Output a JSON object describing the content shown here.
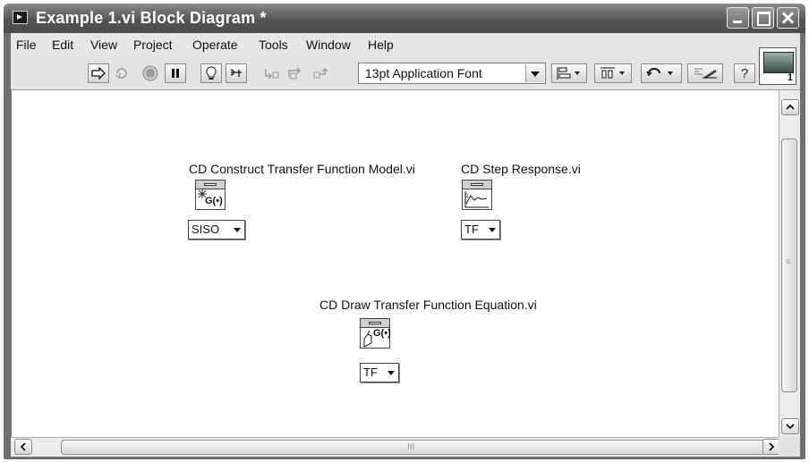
{
  "window": {
    "title": "Example 1.vi Block Diagram *"
  },
  "menu": {
    "items": [
      "File",
      "Edit",
      "View",
      "Project",
      "Operate",
      "Tools",
      "Window",
      "Help"
    ]
  },
  "toolbar": {
    "buttons": [
      "run-arrow-icon",
      "run-continuously-icon",
      "abort-icon",
      "pause-icon",
      "highlight-execution-icon",
      "retain-wire-values-icon",
      "step-into-icon",
      "step-over-icon",
      "step-out-icon"
    ],
    "font": "13pt Application Font",
    "help_label": "?",
    "connector_pane_number": "1"
  },
  "diagram": {
    "nodes": [
      {
        "label": "CD Construct Transfer Function Model.vi",
        "icon": "transfer-function-model-icon",
        "glyph": "G(•)",
        "selector": "SISO"
      },
      {
        "label": "CD Step Response.vi",
        "icon": "step-response-icon",
        "glyph": "",
        "selector": "TF"
      },
      {
        "label": "CD Draw Transfer Function Equation.vi",
        "icon": "draw-equation-icon",
        "glyph": "G(•)",
        "selector": "TF"
      }
    ]
  },
  "scrollbar": {
    "grip_horizontal": "III",
    "grip_vertical": "≡"
  }
}
